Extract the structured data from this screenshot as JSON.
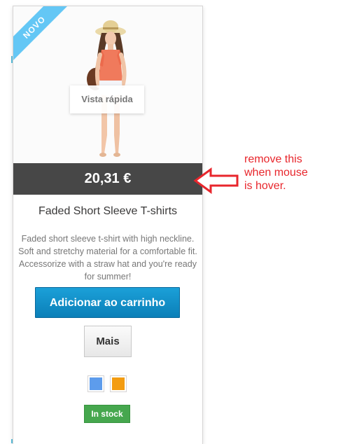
{
  "product": {
    "badge": "NOVO",
    "quick_view": "Vista rápida",
    "price": "20,31 €",
    "name": "Faded Short Sleeve T-shirts",
    "description": "Faded short sleeve t-shirt with high neckline. Soft and stretchy material for a comfortable fit. Accessorize with a straw hat and you're ready for summer!",
    "add_to_cart": "Adicionar ao carrinho",
    "more": "Mais",
    "color_swatches": [
      {
        "color": "#5d9cec"
      },
      {
        "color": "#f39c11"
      }
    ],
    "availability": "In stock"
  },
  "annotation": {
    "lines": [
      "remove this",
      "when mouse",
      "is hover."
    ],
    "color": "#e8262c"
  },
  "colors": {
    "price_bar": "#474747",
    "cart_button": "#0e8fcb",
    "badge": "#64c7f5",
    "stock_badge": "#46a74e"
  }
}
